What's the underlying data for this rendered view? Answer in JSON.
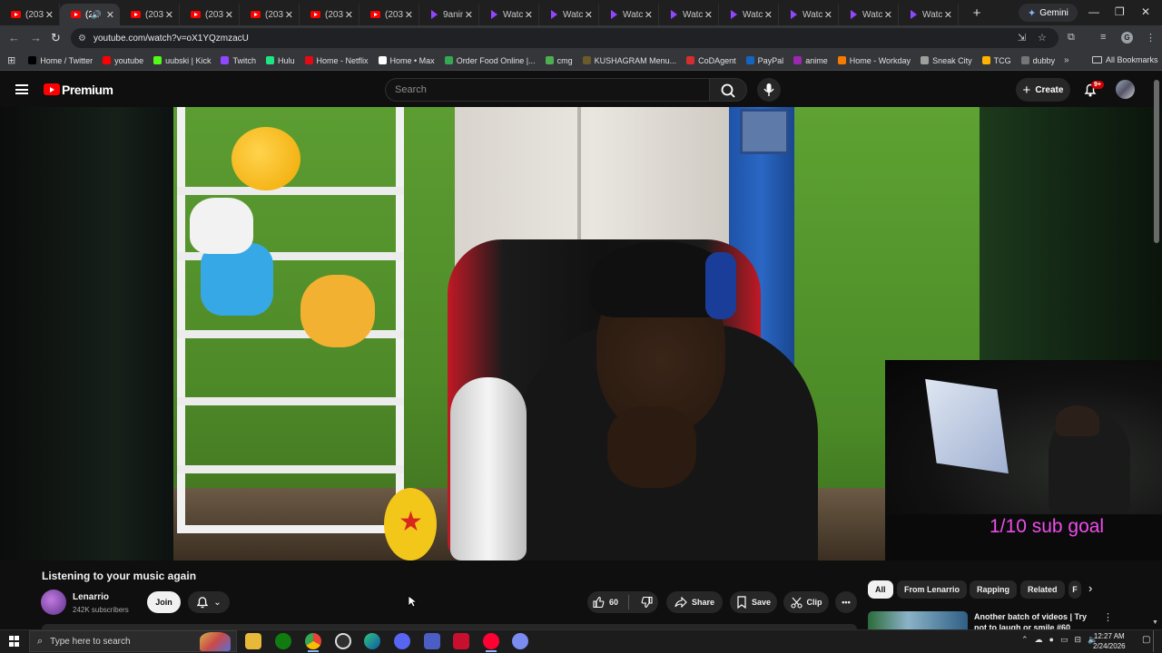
{
  "browser": {
    "tabs": [
      {
        "title": "(203",
        "favicon": "youtube-icon",
        "active": false
      },
      {
        "title": "(2",
        "favicon": "youtube-icon",
        "active": true,
        "audio": true
      },
      {
        "title": "(203",
        "favicon": "youtube-icon",
        "active": false
      },
      {
        "title": "(203",
        "favicon": "youtube-icon",
        "active": false
      },
      {
        "title": "(203",
        "favicon": "youtube-icon",
        "active": false
      },
      {
        "title": "(203",
        "favicon": "youtube-icon",
        "active": false
      },
      {
        "title": "(203",
        "favicon": "youtube-icon",
        "active": false
      },
      {
        "title": "9anin",
        "favicon": "twitch-icon",
        "active": false
      },
      {
        "title": "Watc",
        "favicon": "twitch-icon",
        "active": false
      },
      {
        "title": "Watc",
        "favicon": "twitch-icon",
        "active": false
      },
      {
        "title": "Watc",
        "favicon": "twitch-icon",
        "active": false
      },
      {
        "title": "Watc",
        "favicon": "twitch-icon",
        "active": false
      },
      {
        "title": "Watc",
        "favicon": "twitch-icon",
        "active": false
      },
      {
        "title": "Watc",
        "favicon": "twitch-icon",
        "active": false
      },
      {
        "title": "Watc",
        "favicon": "twitch-icon",
        "active": false
      },
      {
        "title": "Watc",
        "favicon": "twitch-icon",
        "active": false
      }
    ],
    "gemini_label": "Gemini",
    "url": "youtube.com/watch?v=oX1YQzmzacU",
    "profile_initial": "G",
    "bookmarks": [
      {
        "label": "Home / Twitter",
        "color": "#000000"
      },
      {
        "label": "youtube",
        "color": "#ff0000"
      },
      {
        "label": "uubski | Kick",
        "color": "#53fc18"
      },
      {
        "label": "Twitch",
        "color": "#9146ff"
      },
      {
        "label": "Hulu",
        "color": "#1ce783"
      },
      {
        "label": "Home - Netflix",
        "color": "#e50914"
      },
      {
        "label": "Home • Max",
        "color": "#ffffff"
      },
      {
        "label": "Order Food Online |...",
        "color": "#34a853"
      },
      {
        "label": "cmg",
        "color": "#4caf50"
      },
      {
        "label": "KUSHAGRAM Menu...",
        "color": "#6b5a2a"
      },
      {
        "label": "CoDAgent",
        "color": "#d32f2f"
      },
      {
        "label": "PayPal",
        "color": "#1565c0"
      },
      {
        "label": "anime",
        "color": "#9c27b0"
      },
      {
        "label": "Home - Workday",
        "color": "#f57c00"
      },
      {
        "label": "Sneak City",
        "color": "#9e9e9e"
      },
      {
        "label": "TCG",
        "color": "#ffb300"
      },
      {
        "label": "dubby",
        "color": "#757575"
      }
    ],
    "all_bookmarks_label": "All Bookmarks"
  },
  "youtube": {
    "brand": "Premium",
    "search_placeholder": "Search",
    "create_label": "Create",
    "notification_count": "9+",
    "overlay_text": "1/10 sub goal",
    "video_title": "Listening to your music again",
    "channel": {
      "name": "Lenarrio",
      "subscribers": "242K subscribers"
    },
    "join_label": "Join",
    "like_count": "60",
    "share_label": "Share",
    "save_label": "Save",
    "clip_label": "Clip",
    "chips": [
      "All",
      "From Lenarrio",
      "Rapping",
      "Related",
      "F"
    ],
    "recommendation": {
      "title": "Another batch of videos | Try not to laugh or smile #60"
    }
  },
  "taskbar": {
    "search_placeholder": "Type here to search",
    "apps": [
      "file-explorer-icon",
      "xbox-icon",
      "chrome-icon",
      "obs-icon",
      "edge-icon",
      "discord-icon",
      "game-controller-icon",
      "media-app-icon",
      "youtube-music-icon",
      "circle-app-icon"
    ],
    "time": "12:27 AM",
    "date": "2/24/2026"
  }
}
